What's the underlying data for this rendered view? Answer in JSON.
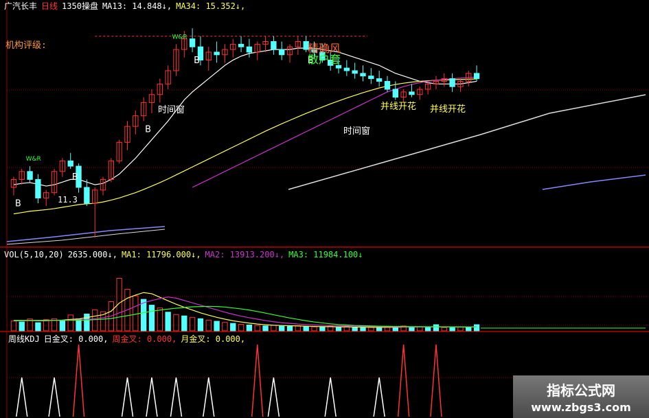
{
  "colors": {
    "up": "#ff3333",
    "down": "#55ffff",
    "grid": "#8b0000",
    "yellow": "#ffff55",
    "magenta": "#cc33cc",
    "white": "#ffffff",
    "green": "#33ff33"
  },
  "header": {
    "stock": "广汽长丰",
    "period": "日线",
    "code": "1350",
    "label": "操盘",
    "ma13": "MA13: 14.848↓,",
    "ma34": "MA34: 15.352↓,"
  },
  "annotations": {
    "jigou": "机构评级:",
    "jingque": "精确风",
    "sanhu": "散户套",
    "shijianchuang": "时间窗",
    "bingxian": "并线开花",
    "low_price": "11.3",
    "b": "B",
    "war": "W&R"
  },
  "vol_header": {
    "name": "VOL(5,10,20)",
    "value": "2635.000↓,",
    "ma1": "MA1: 11796.000↓,",
    "ma2": "MA2: 13913.200↓,",
    "ma3": "MA3: 11984.100↓"
  },
  "kdj_header": {
    "name": "周线KDJ",
    "day": "日金叉: 0.000,",
    "week": "周金叉: 0.000,",
    "month": "月金叉: 0.000,"
  },
  "watermark": {
    "line1": "指标公式网",
    "line2": "www.zbgs3.com"
  },
  "chart_data": {
    "type": "candlestick",
    "candles": [
      [
        13.2,
        13.6,
        12.9,
        13.5
      ],
      [
        13.5,
        13.9,
        13.3,
        13.8
      ],
      [
        13.8,
        14.0,
        13.4,
        13.5
      ],
      [
        13.5,
        13.7,
        12.6,
        12.8
      ],
      [
        12.8,
        13.1,
        12.5,
        13.0
      ],
      [
        13.0,
        13.9,
        12.9,
        13.8
      ],
      [
        13.8,
        14.3,
        13.6,
        14.2
      ],
      [
        14.2,
        14.5,
        13.9,
        14.0
      ],
      [
        14.0,
        14.1,
        13.0,
        13.2
      ],
      [
        13.2,
        13.5,
        12.5,
        12.6
      ],
      [
        12.6,
        13.2,
        11.3,
        13.1
      ],
      [
        13.1,
        13.6,
        12.9,
        13.5
      ],
      [
        13.5,
        14.3,
        13.4,
        14.2
      ],
      [
        14.2,
        15.0,
        14.1,
        14.9
      ],
      [
        14.9,
        15.7,
        14.6,
        15.5
      ],
      [
        15.5,
        16.1,
        15.2,
        15.9
      ],
      [
        15.9,
        16.6,
        15.7,
        16.4
      ],
      [
        16.4,
        16.9,
        16.0,
        16.7
      ],
      [
        16.7,
        17.3,
        16.4,
        17.1
      ],
      [
        17.1,
        17.8,
        16.9,
        17.6
      ],
      [
        17.6,
        18.6,
        17.4,
        18.4
      ],
      [
        18.4,
        19.1,
        18.1,
        18.8
      ],
      [
        18.8,
        19.2,
        18.3,
        18.5
      ],
      [
        18.5,
        18.9,
        17.8,
        18.0
      ],
      [
        18.0,
        18.5,
        17.6,
        18.3
      ],
      [
        18.3,
        18.7,
        17.9,
        18.2
      ],
      [
        18.2,
        18.6,
        17.9,
        18.4
      ],
      [
        18.4,
        18.8,
        18.1,
        18.6
      ],
      [
        18.6,
        18.9,
        18.3,
        18.5
      ],
      [
        18.5,
        18.8,
        18.1,
        18.3
      ],
      [
        18.3,
        18.7,
        18.0,
        18.6
      ],
      [
        18.6,
        18.9,
        18.3,
        18.7
      ],
      [
        18.7,
        18.9,
        18.2,
        18.4
      ],
      [
        18.4,
        18.7,
        18.0,
        18.2
      ],
      [
        18.2,
        18.6,
        17.9,
        18.5
      ],
      [
        18.5,
        18.9,
        18.2,
        18.7
      ],
      [
        18.7,
        18.9,
        18.3,
        18.4
      ],
      [
        18.4,
        18.7,
        18.1,
        18.3
      ],
      [
        18.3,
        18.6,
        17.9,
        18.0
      ],
      [
        18.0,
        18.3,
        17.6,
        17.8
      ],
      [
        17.8,
        18.1,
        17.5,
        17.7
      ],
      [
        17.7,
        18.0,
        17.4,
        17.6
      ],
      [
        17.6,
        17.9,
        17.3,
        17.5
      ],
      [
        17.5,
        17.8,
        17.2,
        17.4
      ],
      [
        17.4,
        17.7,
        17.1,
        17.3
      ],
      [
        17.3,
        17.6,
        17.0,
        17.2
      ],
      [
        17.2,
        17.4,
        16.8,
        16.9
      ],
      [
        16.9,
        17.2,
        16.5,
        16.6
      ],
      [
        16.6,
        16.9,
        16.4,
        16.8
      ],
      [
        16.8,
        17.1,
        16.6,
        16.7
      ],
      [
        16.7,
        17.0,
        16.5,
        16.9
      ],
      [
        16.9,
        17.2,
        16.7,
        17.1
      ],
      [
        17.1,
        17.4,
        16.9,
        17.2
      ],
      [
        17.2,
        17.5,
        17.0,
        17.3
      ],
      [
        17.3,
        17.5,
        16.8,
        17.0
      ],
      [
        17.0,
        17.3,
        16.8,
        17.2
      ],
      [
        17.2,
        17.6,
        17.0,
        17.5
      ],
      [
        17.5,
        17.8,
        17.2,
        17.3
      ]
    ],
    "ma13": [
      13.3,
      13.35,
      13.38,
      13.32,
      13.25,
      13.3,
      13.4,
      13.5,
      13.5,
      13.4,
      13.3,
      13.35,
      13.5,
      13.7,
      14.0,
      14.3,
      14.65,
      15.0,
      15.35,
      15.7,
      16.1,
      16.5,
      16.8,
      17.05,
      17.3,
      17.55,
      17.8,
      18.0,
      18.15,
      18.25,
      18.3,
      18.35,
      18.4,
      18.4,
      18.4,
      18.45,
      18.45,
      18.45,
      18.4,
      18.35,
      18.3,
      18.2,
      18.1,
      18.0,
      17.9,
      17.8,
      17.65,
      17.5,
      17.4,
      17.3,
      17.2,
      17.15,
      17.1,
      17.1,
      17.1,
      17.1,
      17.15,
      17.2
    ],
    "ma34": [
      12.2,
      12.25,
      12.3,
      12.33,
      12.36,
      12.4,
      12.45,
      12.5,
      12.55,
      12.58,
      12.6,
      12.65,
      12.72,
      12.8,
      12.9,
      13.0,
      13.12,
      13.25,
      13.38,
      13.52,
      13.67,
      13.82,
      13.97,
      14.12,
      14.27,
      14.42,
      14.57,
      14.72,
      14.87,
      15.02,
      15.17,
      15.32,
      15.46,
      15.6,
      15.73,
      15.86,
      15.99,
      16.11,
      16.23,
      16.35,
      16.46,
      16.57,
      16.67,
      16.77,
      16.86,
      16.95,
      17.02,
      17.08,
      17.13,
      17.17,
      17.2,
      17.22,
      17.24,
      17.25,
      17.26,
      17.27,
      17.28,
      17.29
    ],
    "ma_magenta": [
      null,
      null,
      null,
      null,
      null,
      null,
      null,
      null,
      null,
      null,
      null,
      null,
      null,
      null,
      null,
      null,
      null,
      null,
      null,
      null,
      null,
      null,
      13.2,
      13.35,
      13.5,
      13.65,
      13.8,
      13.95,
      14.1,
      14.25,
      14.4,
      14.55,
      14.7,
      14.85,
      15.0,
      15.15,
      15.3,
      15.45,
      15.6,
      15.75,
      15.9,
      16.05,
      16.2,
      16.35,
      16.5,
      16.65,
      16.8,
      16.9,
      17.0,
      17.08,
      17.15,
      17.2,
      17.24,
      17.27,
      17.3,
      17.32,
      17.34,
      17.36
    ],
    "volume_scale": [
      0,
      30000
    ],
    "volumes": [
      {
        "v": 4200,
        "up": 1
      },
      {
        "v": 3800,
        "up": 0
      },
      {
        "v": 5100,
        "up": 1
      },
      {
        "v": 3500,
        "up": 0
      },
      {
        "v": 4800,
        "up": 1
      },
      {
        "v": 5200,
        "up": 1
      },
      {
        "v": 4300,
        "up": 0
      },
      {
        "v": 6800,
        "up": 1
      },
      {
        "v": 5100,
        "up": 0
      },
      {
        "v": 7200,
        "up": 0
      },
      {
        "v": 9000,
        "up": 1
      },
      {
        "v": 8200,
        "up": 1
      },
      {
        "v": 12500,
        "up": 1
      },
      {
        "v": 22500,
        "up": 1
      },
      {
        "v": 17800,
        "up": 1
      },
      {
        "v": 15000,
        "up": 1
      },
      {
        "v": 13500,
        "up": 0
      },
      {
        "v": 11000,
        "up": 0
      },
      {
        "v": 9800,
        "up": 1
      },
      {
        "v": 8000,
        "up": 0
      },
      {
        "v": 7000,
        "up": 1
      },
      {
        "v": 6400,
        "up": 0
      },
      {
        "v": 5800,
        "up": 1
      },
      {
        "v": 5200,
        "up": 0
      },
      {
        "v": 4600,
        "up": 1
      },
      {
        "v": 4100,
        "up": 0
      },
      {
        "v": 3600,
        "up": 1
      },
      {
        "v": 3200,
        "up": 0
      },
      {
        "v": 2800,
        "up": 1
      },
      {
        "v": 2500,
        "up": 0
      },
      {
        "v": 2300,
        "up": 1
      },
      {
        "v": 2100,
        "up": 0
      },
      {
        "v": 2400,
        "up": 1
      },
      {
        "v": 2000,
        "up": 0
      },
      {
        "v": 1900,
        "up": 0
      },
      {
        "v": 2200,
        "up": 1
      },
      {
        "v": 1800,
        "up": 0
      },
      {
        "v": 1700,
        "up": 1
      },
      {
        "v": 1600,
        "up": 0
      },
      {
        "v": 2000,
        "up": 1
      },
      {
        "v": 1500,
        "up": 0
      },
      {
        "v": 1800,
        "up": 1
      },
      {
        "v": 1400,
        "up": 0
      },
      {
        "v": 1300,
        "up": 0
      },
      {
        "v": 1600,
        "up": 1
      },
      {
        "v": 1200,
        "up": 0
      },
      {
        "v": 1500,
        "up": 1
      },
      {
        "v": 1700,
        "up": 0
      },
      {
        "v": 2100,
        "up": 1
      },
      {
        "v": 1600,
        "up": 0
      },
      {
        "v": 1800,
        "up": 1
      },
      {
        "v": 1500,
        "up": 0
      },
      {
        "v": 2635,
        "up": 0
      },
      {
        "v": 1400,
        "up": 1
      },
      {
        "v": 1300,
        "up": 0
      },
      {
        "v": 1700,
        "up": 1
      },
      {
        "v": 1500,
        "up": 0
      },
      {
        "v": 2635,
        "up": 0
      }
    ],
    "vol_ma1": [
      4300,
      4300,
      4400,
      4300,
      4300,
      4500,
      4600,
      4900,
      5100,
      5700,
      6300,
      6900,
      8400,
      11900,
      14000,
      15300,
      16400,
      15900,
      14400,
      12900,
      11400,
      10100,
      8900,
      7700,
      6700,
      5800,
      5000,
      4300,
      3800,
      3300,
      2900,
      2600,
      2400,
      2300,
      2200,
      2100,
      2000,
      1900,
      1800,
      1800,
      1700,
      1700,
      1600,
      1600,
      1500,
      1500,
      1500,
      1500,
      1600,
      1600,
      1700,
      1700,
      1800,
      1700,
      1700,
      1600,
      1600,
      1700
    ],
    "vol_ma2": [
      4400,
      4400,
      4400,
      4400,
      4400,
      4400,
      4500,
      4600,
      4700,
      4800,
      5200,
      5600,
      6300,
      7700,
      9000,
      10500,
      12000,
      13000,
      13800,
      14500,
      14000,
      13000,
      12000,
      11000,
      10000,
      9000,
      8000,
      7100,
      6300,
      5600,
      5000,
      4400,
      3900,
      3500,
      3200,
      2900,
      2700,
      2500,
      2400,
      2300,
      2200,
      2100,
      2000,
      1900,
      1850,
      1800,
      1750,
      1700,
      1700,
      1700,
      1700,
      1700,
      1750,
      1750,
      1700,
      1700,
      1700,
      1700
    ],
    "vol_ma3": [
      4500,
      4500,
      4500,
      4500,
      4500,
      4500,
      4500,
      4500,
      4500,
      4600,
      4800,
      5000,
      5300,
      5900,
      6500,
      7100,
      7800,
      8400,
      8900,
      9300,
      9700,
      10000,
      10300,
      10400,
      10500,
      10400,
      10200,
      9800,
      9400,
      8900,
      8300,
      7600,
      6900,
      6200,
      5500,
      4900,
      4300,
      3800,
      3400,
      3000,
      2700,
      2500,
      2300,
      2200,
      2100,
      2000,
      1950,
      1900,
      1850,
      1800,
      1780,
      1760,
      1740,
      1720,
      1700,
      1690,
      1680,
      1670
    ],
    "kdj_red_peaks": [
      8,
      30,
      48,
      52
    ],
    "kdj_white_peaks": [
      1,
      5,
      14,
      17,
      20,
      24,
      32,
      39,
      45
    ],
    "buy_markers": [
      0,
      7,
      16,
      22,
      36
    ],
    "war_markers": [
      2,
      20
    ]
  }
}
